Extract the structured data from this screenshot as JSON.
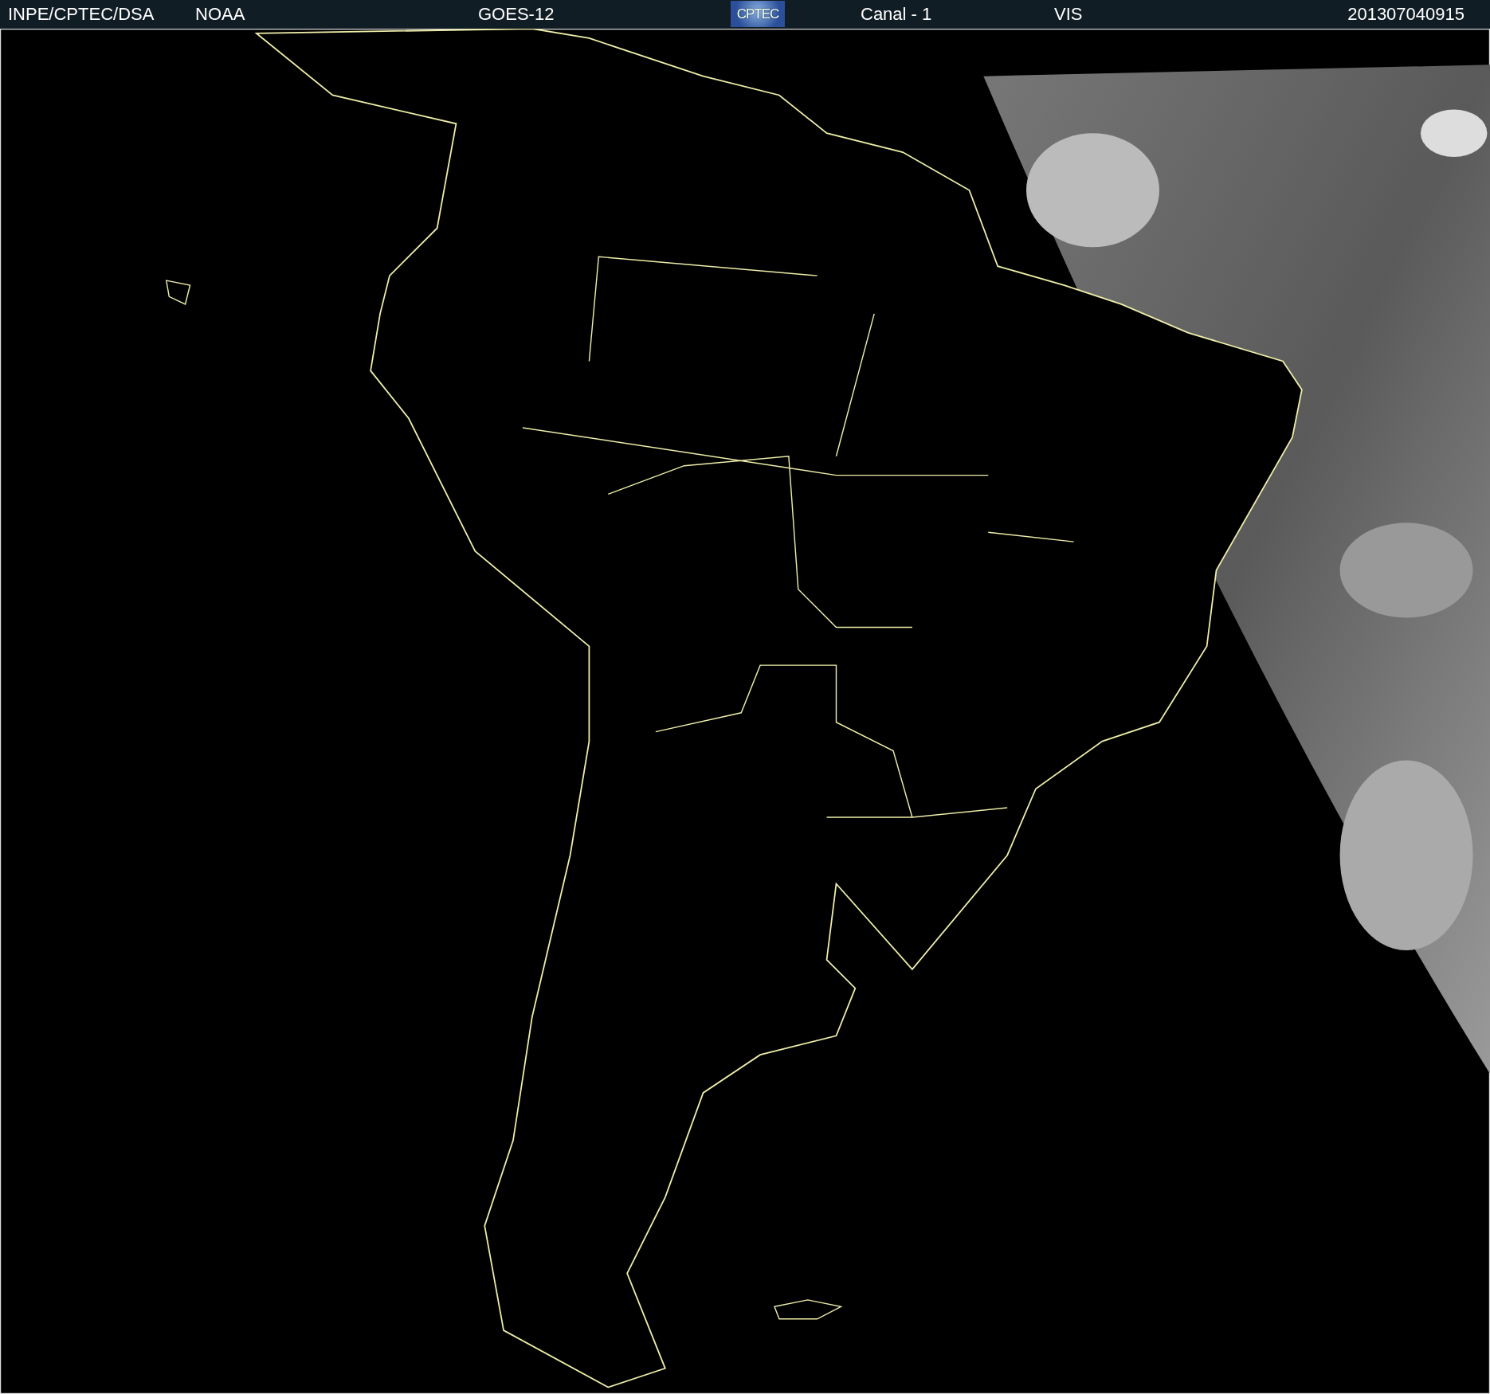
{
  "header": {
    "source": "INPE/CPTEC/DSA",
    "agency": "NOAA",
    "satellite": "GOES-12",
    "logo_text": "CPTEC",
    "channel": "Canal - 1",
    "band": "VIS",
    "timestamp": "201307040915"
  }
}
